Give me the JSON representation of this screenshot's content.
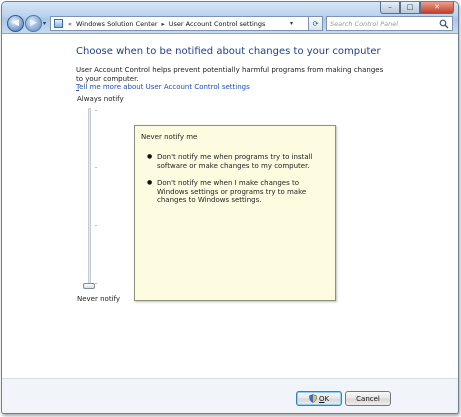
{
  "window": {
    "minimize_glyph": "–",
    "maximize_glyph": "□",
    "close_glyph": "✕"
  },
  "nav": {
    "back_glyph": "◀",
    "forward_glyph": "▶",
    "dropdown_glyph": "▾"
  },
  "address": {
    "lead_sep": "«",
    "crumbs": [
      "Windows Solution Center",
      "User Account Control settings"
    ],
    "sep": "▸",
    "chevron": "▾",
    "refresh_glyph": "⟳"
  },
  "search": {
    "placeholder": "Search Control Panel",
    "icon": "search-icon"
  },
  "main": {
    "title": "Choose when to be notified about changes to your computer",
    "description": "User Account Control helps prevent potentially harmful programs from making changes to your computer.",
    "learn_link_first": "T",
    "learn_link_rest": "ell me more about User Account Control settings",
    "slider": {
      "top_label": "Always notify",
      "bottom_label": "Never notify",
      "levels": 4,
      "selected_level": 1
    },
    "info": {
      "title": "Never notify me",
      "bullet_glyph": "●",
      "bullets": [
        "Don't notify me when programs try to install software or make changes to my computer.",
        "Don't notify me when I make changes to Windows settings or programs try to make changes to Windows settings."
      ]
    }
  },
  "footer": {
    "ok_label_first": "O",
    "ok_label_rest": "K",
    "cancel_label": "Cancel"
  },
  "colors": {
    "title_blue": "#1e3f8c",
    "link_blue": "#1d4fb0",
    "info_bg": "#fdfce1"
  }
}
